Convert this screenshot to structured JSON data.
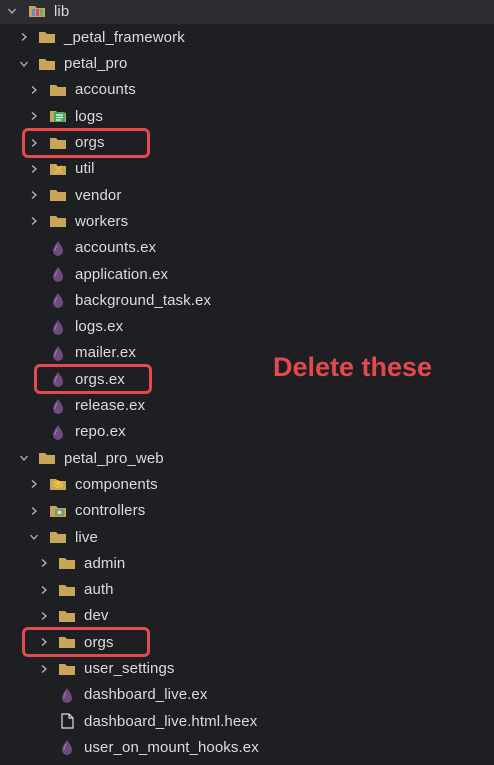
{
  "tree": [
    {
      "label": "lib",
      "depth": 0,
      "kind": "folder-special",
      "expanded": true,
      "icon": "lib-folder-icon"
    },
    {
      "label": "_petal_framework",
      "depth": 1,
      "kind": "folder",
      "expanded": false
    },
    {
      "label": "petal_pro",
      "depth": 1,
      "kind": "folder",
      "expanded": true
    },
    {
      "label": "accounts",
      "depth": 2,
      "kind": "folder",
      "expanded": false
    },
    {
      "label": "logs",
      "depth": 2,
      "kind": "folder-logs",
      "expanded": false
    },
    {
      "label": "orgs",
      "depth": 2,
      "kind": "folder",
      "expanded": false,
      "highlight": true
    },
    {
      "label": "util",
      "depth": 2,
      "kind": "folder-util",
      "expanded": false
    },
    {
      "label": "vendor",
      "depth": 2,
      "kind": "folder",
      "expanded": false
    },
    {
      "label": "workers",
      "depth": 2,
      "kind": "folder",
      "expanded": false
    },
    {
      "label": "accounts.ex",
      "depth": 2,
      "kind": "elixir"
    },
    {
      "label": "application.ex",
      "depth": 2,
      "kind": "elixir"
    },
    {
      "label": "background_task.ex",
      "depth": 2,
      "kind": "elixir"
    },
    {
      "label": "logs.ex",
      "depth": 2,
      "kind": "elixir"
    },
    {
      "label": "mailer.ex",
      "depth": 2,
      "kind": "elixir"
    },
    {
      "label": "orgs.ex",
      "depth": 2,
      "kind": "elixir",
      "highlight": true
    },
    {
      "label": "release.ex",
      "depth": 2,
      "kind": "elixir"
    },
    {
      "label": "repo.ex",
      "depth": 2,
      "kind": "elixir"
    },
    {
      "label": "petal_pro_web",
      "depth": 1,
      "kind": "folder",
      "expanded": true
    },
    {
      "label": "components",
      "depth": 2,
      "kind": "folder-components",
      "expanded": false
    },
    {
      "label": "controllers",
      "depth": 2,
      "kind": "folder-controllers",
      "expanded": false
    },
    {
      "label": "live",
      "depth": 2,
      "kind": "folder",
      "expanded": true
    },
    {
      "label": "admin",
      "depth": 3,
      "kind": "folder",
      "expanded": false
    },
    {
      "label": "auth",
      "depth": 3,
      "kind": "folder",
      "expanded": false
    },
    {
      "label": "dev",
      "depth": 3,
      "kind": "folder",
      "expanded": false
    },
    {
      "label": "orgs",
      "depth": 3,
      "kind": "folder",
      "expanded": false,
      "highlight": true
    },
    {
      "label": "user_settings",
      "depth": 3,
      "kind": "folder",
      "expanded": false
    },
    {
      "label": "dashboard_live.ex",
      "depth": 3,
      "kind": "elixir"
    },
    {
      "label": "dashboard_live.html.heex",
      "depth": 3,
      "kind": "file"
    },
    {
      "label": "user_on_mount_hooks.ex",
      "depth": 3,
      "kind": "elixir"
    }
  ],
  "annotation": "Delete these",
  "colors": {
    "background": "#1e1f22",
    "text": "#dcdcdc",
    "folder": "#c9a55a",
    "elixir": "#6e4a7e",
    "highlight": "#e5484d"
  }
}
